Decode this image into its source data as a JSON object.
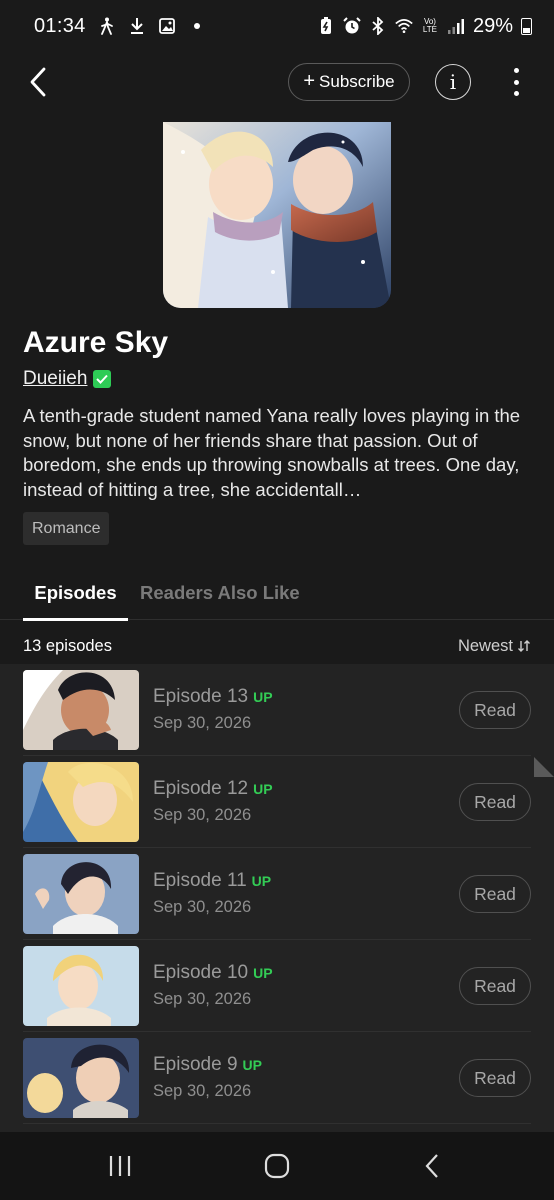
{
  "status_bar": {
    "time": "01:34",
    "battery": "29%",
    "icons": [
      "walking-icon",
      "download-icon",
      "image-icon",
      "dot-icon",
      "battery-saver-icon",
      "alarm-icon",
      "bluetooth-icon",
      "wifi-icon",
      "volte-icon",
      "signal-icon",
      "battery-icon"
    ],
    "volte_label": "Vo) LTE"
  },
  "app_bar": {
    "subscribe_label": "Subscribe",
    "info_label": "i"
  },
  "series": {
    "title": "Azure Sky",
    "author": "Dueiieh",
    "description": "A tenth-grade student named Yana really loves playing in the snow, but none of her friends share that passion. Out of boredom, she ends up throwing snowballs at trees. One day, instead of hitting a tree, she accidentall…",
    "genre": "Romance"
  },
  "tabs": [
    {
      "label": "Episodes",
      "active": true
    },
    {
      "label": "Readers Also Like",
      "active": false
    }
  ],
  "list": {
    "count_label": "13 episodes",
    "sort_label": "Newest",
    "read_label": "Read",
    "episodes": [
      {
        "title": "Episode 13",
        "badge": "UP",
        "date": "Sep 30, 2026"
      },
      {
        "title": "Episode 12",
        "badge": "UP",
        "date": "Sep 30, 2026"
      },
      {
        "title": "Episode 11",
        "badge": "UP",
        "date": "Sep 30, 2026"
      },
      {
        "title": "Episode 10",
        "badge": "UP",
        "date": "Sep 30, 2026"
      },
      {
        "title": "Episode 9",
        "badge": "UP",
        "date": "Sep 30, 2026"
      }
    ]
  },
  "colors": {
    "background": "#1a1a1a",
    "list_background": "#232323",
    "up_badge": "#33cc55",
    "verified": "#2ecc56"
  }
}
